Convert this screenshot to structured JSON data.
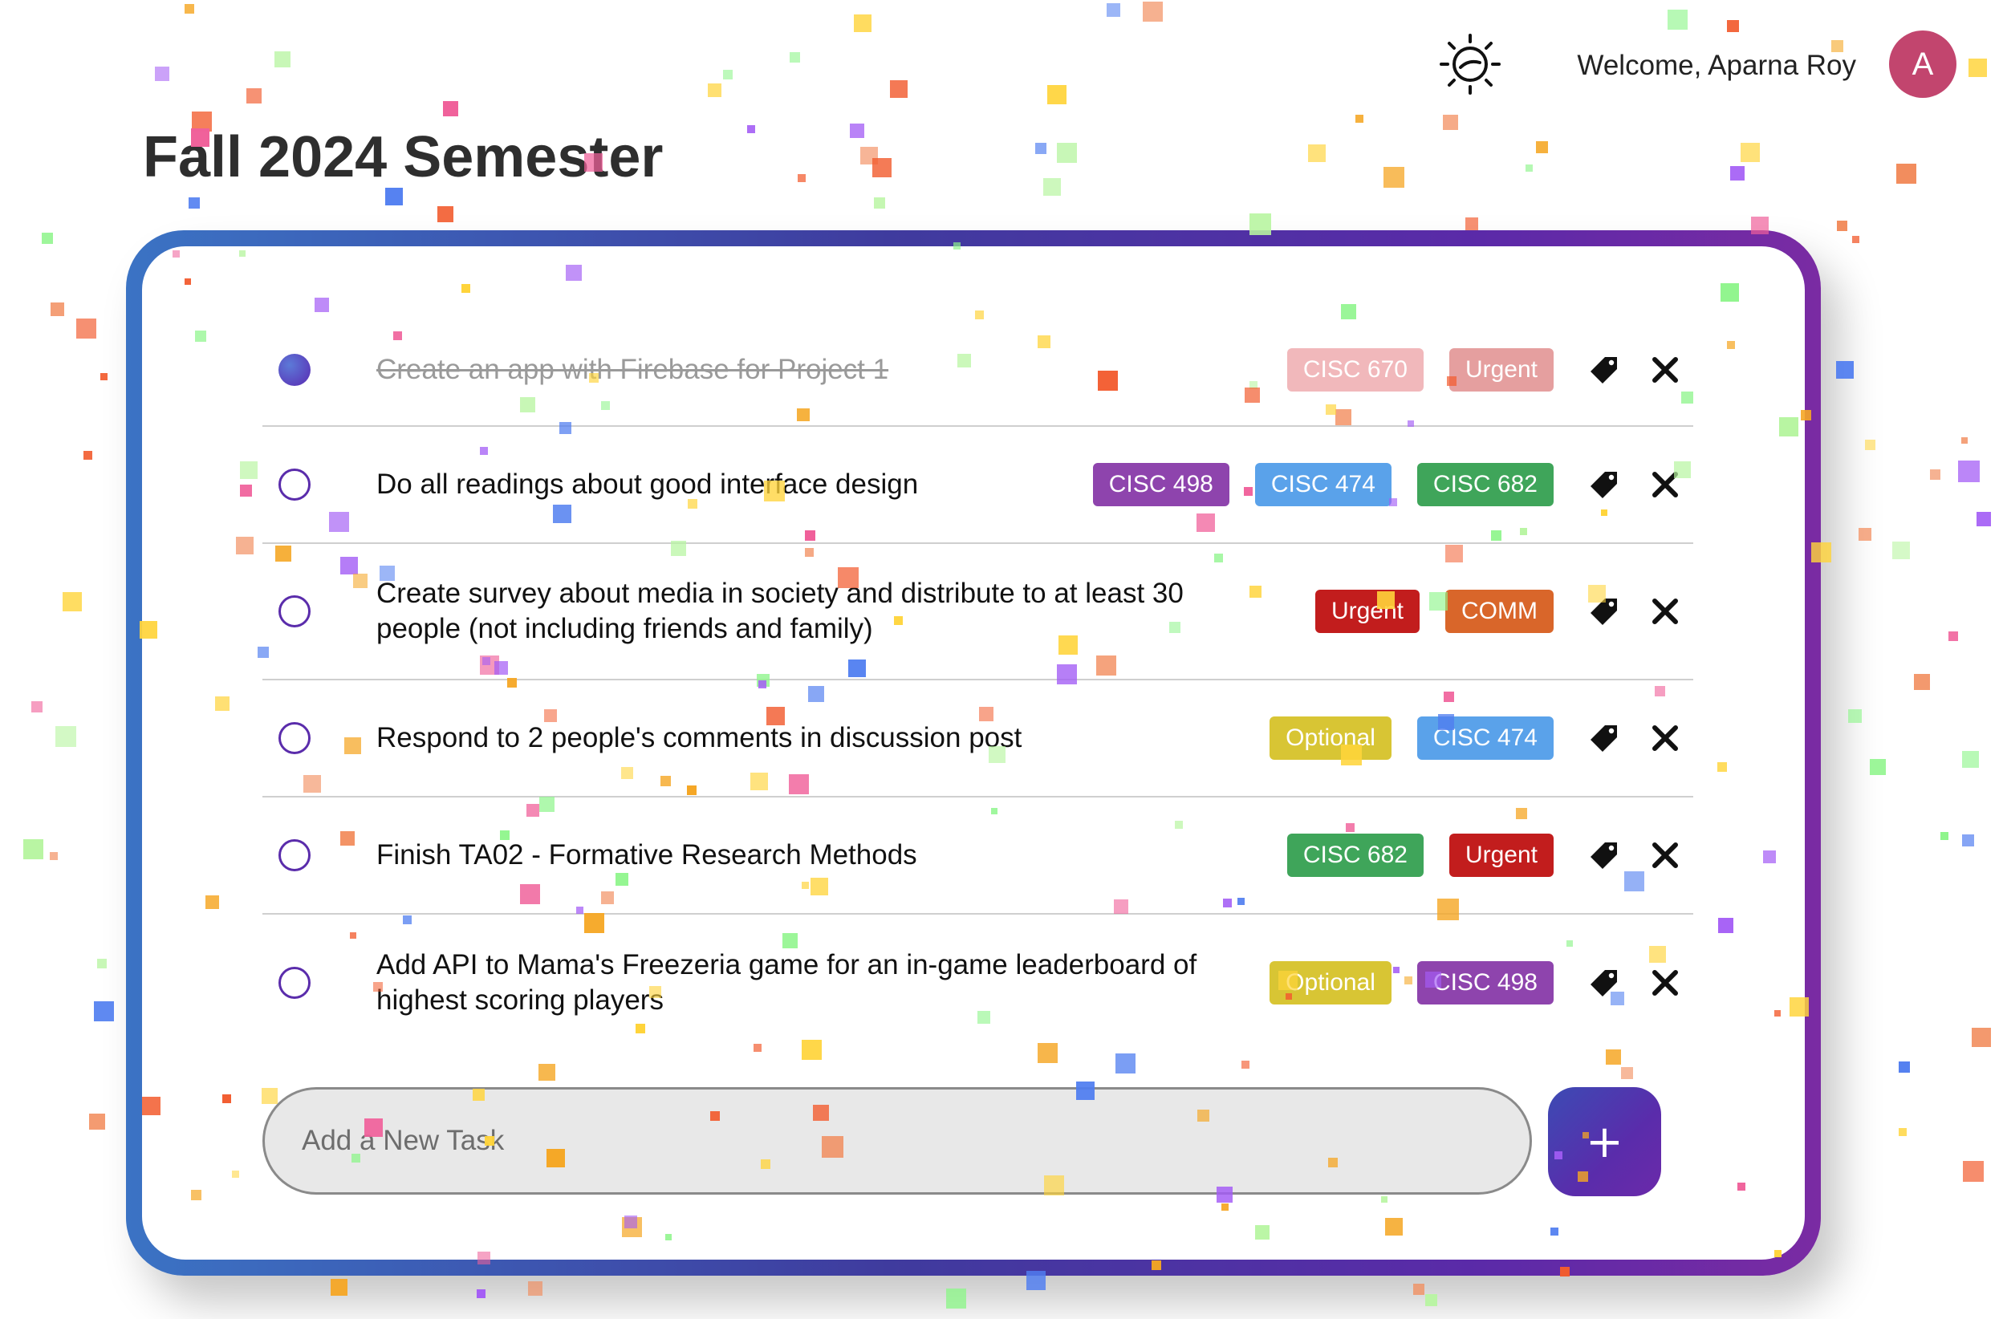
{
  "header": {
    "welcome": "Welcome, Aparna Roy",
    "avatar_initial": "A",
    "theme_icon": "theme-toggle-sun-moon-icon",
    "title": "Fall 2024 Semester"
  },
  "colors": {
    "card_gradient": [
      "#3b73c4",
      "#5b2aa8",
      "#7a2ba3"
    ],
    "avatar": "#c2456e",
    "checkbox": "#5a2cab"
  },
  "tasks": [
    {
      "text": "Create an app with Firebase for Project 1",
      "completed": true,
      "tags": [
        {
          "label": "CISC 670",
          "color": "#e0585f"
        },
        {
          "label": "Urgent",
          "color": "#c21d1d"
        }
      ]
    },
    {
      "text": "Do all readings about good interface design",
      "completed": false,
      "tags": [
        {
          "label": "CISC 498",
          "color": "#8e44ad"
        },
        {
          "label": "CISC 474",
          "color": "#5aa2ea"
        },
        {
          "label": "CISC 682",
          "color": "#3fa55a"
        }
      ]
    },
    {
      "text": "Create survey about media in society and distribute to at least 30 people (not including friends and family)",
      "completed": false,
      "tags": [
        {
          "label": "Urgent",
          "color": "#c21d1d"
        },
        {
          "label": "COMM",
          "color": "#d9662a"
        }
      ]
    },
    {
      "text": "Respond to 2 people's comments in discussion post",
      "completed": false,
      "tags": [
        {
          "label": "Optional",
          "color": "#d8c534"
        },
        {
          "label": "CISC 474",
          "color": "#5aa2ea"
        }
      ]
    },
    {
      "text": "Finish TA02 - Formative Research Methods",
      "completed": false,
      "tags": [
        {
          "label": "CISC 682",
          "color": "#3fa55a"
        },
        {
          "label": "Urgent",
          "color": "#c21d1d"
        }
      ]
    },
    {
      "text": "Add API to Mama's Freezeria game for an in-game leaderboard of highest scoring players",
      "completed": false,
      "tags": [
        {
          "label": "Optional",
          "color": "#d8c534"
        },
        {
          "label": "CISC 498",
          "color": "#8e44ad"
        }
      ]
    }
  ],
  "new_task": {
    "placeholder": "Add a New Task",
    "value": "",
    "add_label": "+"
  },
  "confetti_colors": [
    "#f25c2f",
    "#4f7df0",
    "#8ef58b",
    "#a35cf5",
    "#f0609a",
    "#f5a623",
    "#ffd43b",
    "#f28c5c",
    "#b7f5a0"
  ]
}
